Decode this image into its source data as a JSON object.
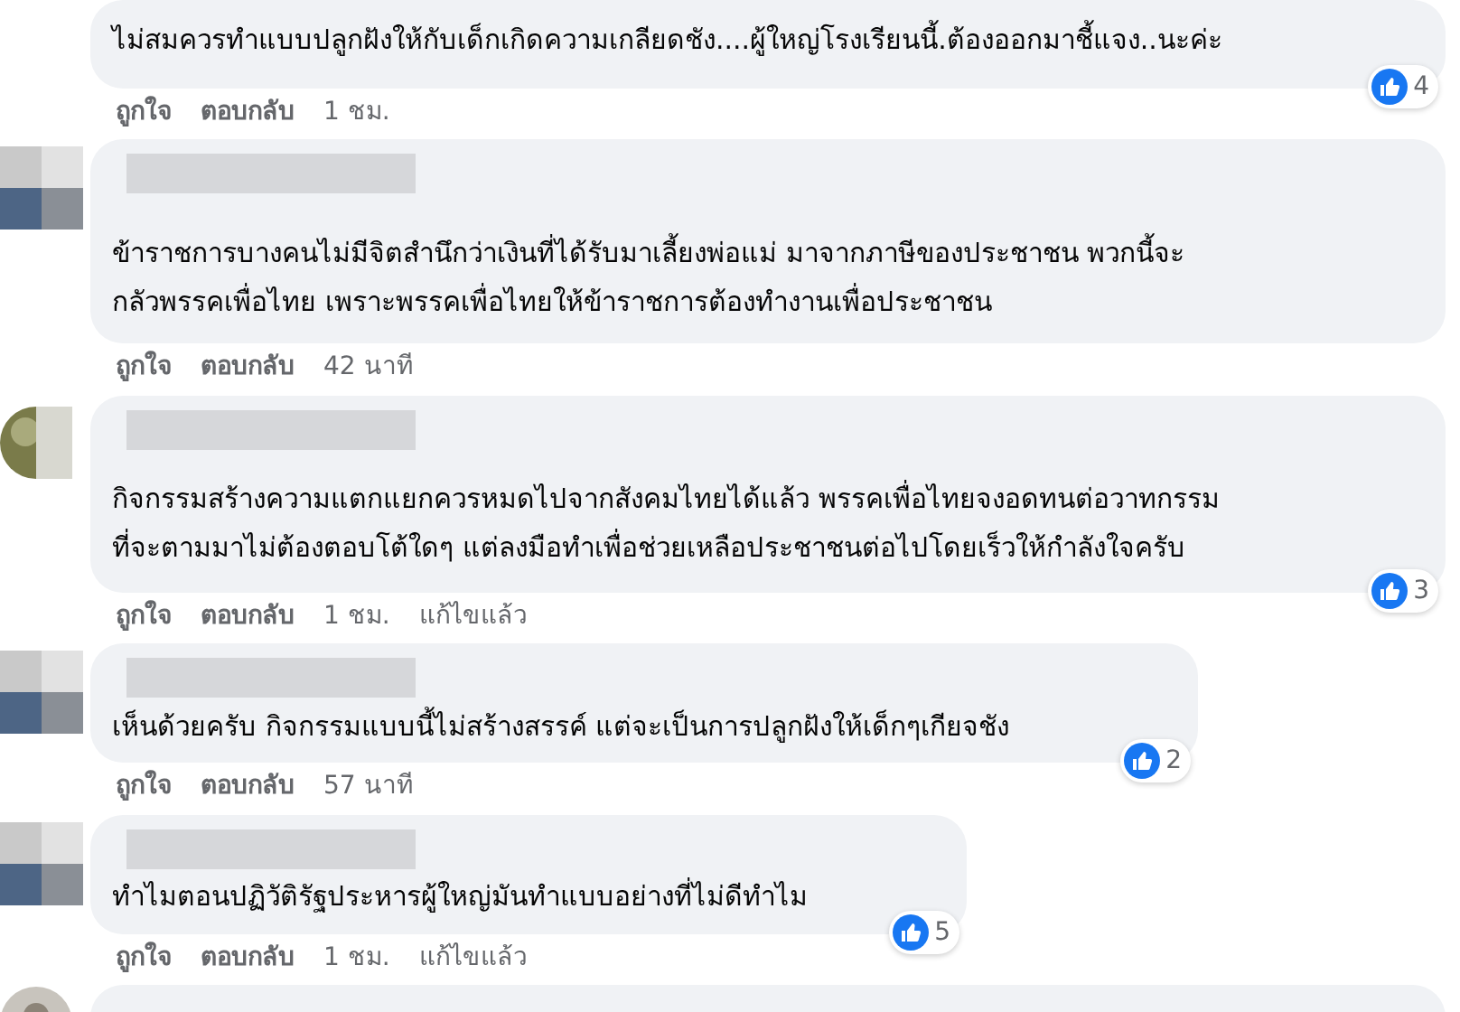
{
  "comments": [
    {
      "text": "ไม่สมควรทำแบบปลูกฝังให้กับเด็กเกิดความเกลียดชัง....ผู้ใหญ่โรงเรียนนี้.ต้องออกมาชี้แจง..นะค่ะ",
      "like": "ถูกใจ",
      "reply": "ตอบกลับ",
      "time": "1 ชม.",
      "reactions": "4"
    },
    {
      "text": "ข้าราชการบางคนไม่มีจิตสำนึกว่าเงินที่ได้รับมาเลี้ยงพ่อแม่ มาจากภาษีของประชาชน พวกนี้จะ\nกลัวพรรคเพื่อไทย เพราะพรรคเพื่อไทยให้ข้าราชการต้องทำงานเพื่อประชาชน",
      "like": "ถูกใจ",
      "reply": "ตอบกลับ",
      "time": "42 นาที"
    },
    {
      "text": "กิจกรรมสร้างความแตกแยกควรหมดไปจากสังคมไทยได้แล้ว พรรคเพื่อไทยจงอดทนต่อวาทกรรม\nที่จะตามมาไม่ต้องตอบโต้ใดๆ แต่ลงมือทำเพื่อช่วยเหลือประชาชนต่อไปโดยเร็วให้กำลังใจครับ",
      "like": "ถูกใจ",
      "reply": "ตอบกลับ",
      "time": "1 ชม.",
      "edited": "แก้ไขแล้ว",
      "reactions": "3"
    },
    {
      "text": "เห็นด้วยครับ กิจกรรมแบบนี้ไม่สร้างสรรค์ แต่จะเป็นการปลูกฝังให้เด็กๆเกียจชัง",
      "like": "ถูกใจ",
      "reply": "ตอบกลับ",
      "time": "57 นาที",
      "reactions": "2"
    },
    {
      "text": "ทำไมตอนปฏิวัติรัฐประหารผู้ใหญ่มันทำแบบอย่างที่ไม่ดีทำไม",
      "like": "ถูกใจ",
      "reply": "ตอบกลับ",
      "time": "1 ชม.",
      "edited": "แก้ไขแล้ว",
      "reactions": "5"
    }
  ]
}
